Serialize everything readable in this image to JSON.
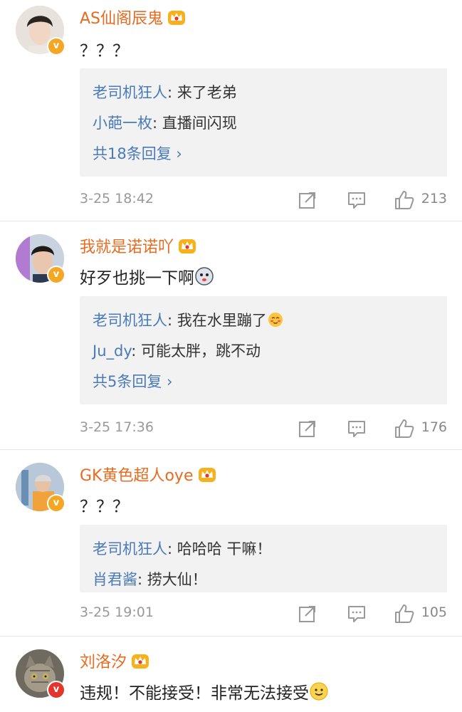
{
  "comments": [
    {
      "username": "AS仙阁辰鬼",
      "content": "？？？",
      "replies": [
        {
          "name": "老司机狂人",
          "text": ": 来了老弟"
        },
        {
          "name": "小葩一枚",
          "text": ": 直播间闪现"
        }
      ],
      "more": "共18条回复 ›",
      "time": "3-25 18:42",
      "likes": "213"
    },
    {
      "username": "我就是诺诺吖",
      "content": "好歹也挑一下啊",
      "replies": [
        {
          "name": "老司机狂人",
          "text": ": 我在水里蹦了"
        },
        {
          "name": "Ju_dy",
          "text": ": 可能太胖，跳不动"
        }
      ],
      "more": "共5条回复 ›",
      "time": "3-25 17:36",
      "likes": "176"
    },
    {
      "username": "GK黄色超人oye",
      "content": "？？？",
      "replies": [
        {
          "name": "老司机狂人",
          "text": ": 哈哈哈 干嘛！"
        },
        {
          "name": "肖君酱",
          "text": ": 捞大仙！"
        }
      ],
      "time": "3-25 19:01",
      "likes": "105"
    },
    {
      "username": "刘洛汐",
      "content": "违规！不能接受！非常无法接受"
    }
  ],
  "colors": {
    "username": "#e86b1f",
    "reply_name": "#4a7ab8",
    "meta": "#999999",
    "badge": "#f5a623"
  },
  "icons": [
    "verified-badge-icon",
    "vip-crown-icon",
    "share-icon",
    "comment-icon",
    "like-icon"
  ]
}
